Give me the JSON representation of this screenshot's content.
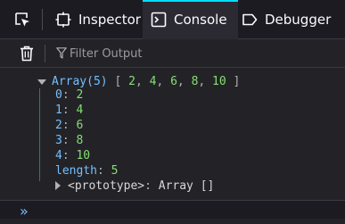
{
  "toolbar": {
    "tabs": [
      {
        "label": "Inspector",
        "icon": "inspector-icon"
      },
      {
        "label": "Console",
        "icon": "console-icon"
      },
      {
        "label": "Debugger",
        "icon": "debugger-icon"
      }
    ],
    "accent_color": "#00ddff"
  },
  "filterbar": {
    "placeholder": "Filter Output"
  },
  "console": {
    "summary_name": "Array(5)",
    "summary_values": [
      "2",
      "4",
      "6",
      "8",
      "10"
    ],
    "entries": [
      {
        "key": "0",
        "value": "2"
      },
      {
        "key": "1",
        "value": "4"
      },
      {
        "key": "2",
        "value": "6"
      },
      {
        "key": "3",
        "value": "8"
      },
      {
        "key": "4",
        "value": "10"
      },
      {
        "key": "length",
        "value": "5"
      }
    ],
    "prototype_key": "<prototype>",
    "prototype_value": "Array []"
  },
  "prompt": {
    "symbol": "»"
  }
}
